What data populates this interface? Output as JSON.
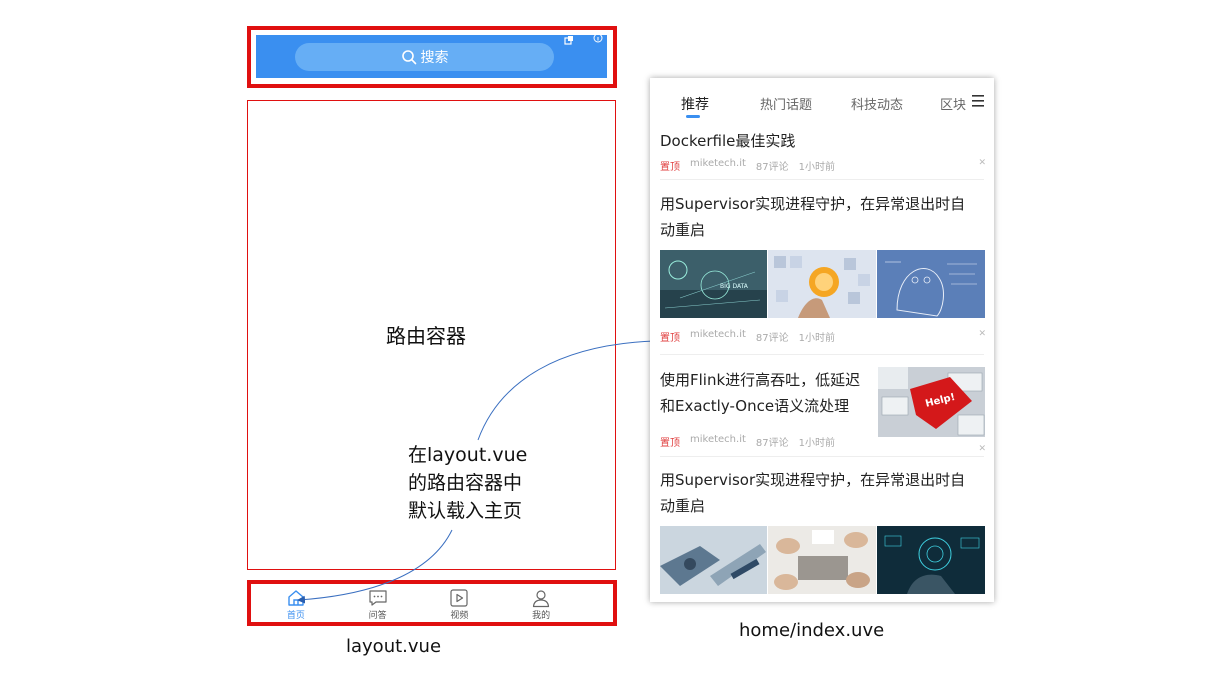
{
  "layout": {
    "search": {
      "label": "搜索"
    },
    "router_label": "路由容器",
    "note_lines": [
      "在layout.vue",
      "的路由容器中",
      "默认载入主页"
    ],
    "tabbar": [
      {
        "label": "首页",
        "icon": "home-icon",
        "active": true
      },
      {
        "label": "问答",
        "icon": "chat-icon",
        "active": false
      },
      {
        "label": "视频",
        "icon": "video-icon",
        "active": false
      },
      {
        "label": "我的",
        "icon": "user-icon",
        "active": false
      }
    ],
    "caption": "layout.vue",
    "accent_color": "#3a8ff0",
    "frame_color": "#e01010"
  },
  "home": {
    "tabs": [
      "推荐",
      "热门话题",
      "科技动态",
      "区块"
    ],
    "articles": [
      {
        "title": "Dockerfile最佳实践",
        "pin": "置顶",
        "source": "miketech.it",
        "comments": "87评论",
        "time": "1小时前"
      },
      {
        "title_line1": "用Supervisor实现进程守护，在异常退出时自",
        "title_line2": "动重启",
        "pin": "置顶",
        "source": "miketech.it",
        "comments": "87评论",
        "time": "1小时前"
      },
      {
        "title_line1": "使用Flink进行高吞吐，低延迟",
        "title_line2": "和Exactly-Once语义流处理",
        "pin": "置顶",
        "source": "miketech.it",
        "comments": "87评论",
        "time": "1小时前",
        "image_text": "Help!"
      },
      {
        "title_line1": "用Supervisor实现进程守护，在异常退出时自",
        "title_line2": "动重启"
      }
    ],
    "thumb_text": "BIG DATA",
    "caption": "home/index.uve"
  }
}
